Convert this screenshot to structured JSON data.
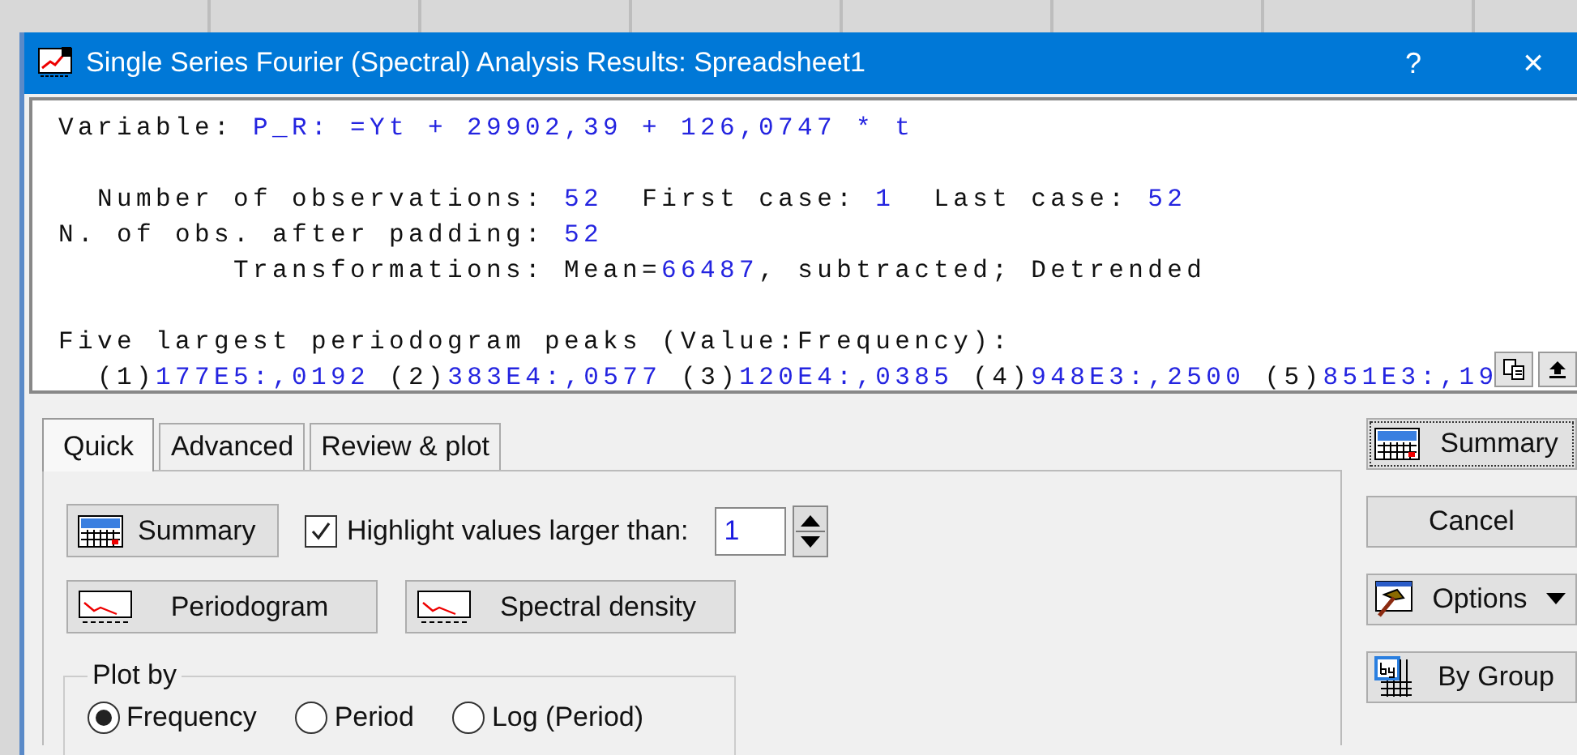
{
  "window": {
    "title": "Single Series Fourier (Spectral) Analysis Results: Spreadsheet1",
    "help": "?",
    "close": "×"
  },
  "output": {
    "blocks": [
      {
        "lines": [
          [
            {
              "kind": "label",
              "text": "Variable: "
            },
            {
              "kind": "value",
              "text": "P_R: =Yt + 29902,39 + 126,0747 * t"
            }
          ]
        ]
      },
      {
        "lines": [
          [
            {
              "kind": "label",
              "text": "  Number of observations: "
            },
            {
              "kind": "value",
              "text": "52"
            },
            {
              "kind": "label",
              "text": "  First case: "
            },
            {
              "kind": "value",
              "text": "1"
            },
            {
              "kind": "label",
              "text": "  Last case: "
            },
            {
              "kind": "value",
              "text": "52"
            }
          ],
          [
            {
              "kind": "label",
              "text": "N. of obs. after padding: "
            },
            {
              "kind": "value",
              "text": "52"
            }
          ],
          [
            {
              "kind": "label",
              "text": "         Transformations: Mean="
            },
            {
              "kind": "value",
              "text": "66487"
            },
            {
              "kind": "label",
              "text": ", subtracted; Detrended"
            }
          ]
        ]
      },
      {
        "lines": [
          [
            {
              "kind": "label",
              "text": "Five largest periodogram peaks (Value:Frequency):"
            }
          ],
          [
            {
              "kind": "label",
              "text": "  (1)"
            },
            {
              "kind": "value",
              "text": "177E5:,0192"
            },
            {
              "kind": "label",
              "text": " (2)"
            },
            {
              "kind": "value",
              "text": "383E4:,0577"
            },
            {
              "kind": "label",
              "text": " (3)"
            },
            {
              "kind": "value",
              "text": "120E4:,0385"
            },
            {
              "kind": "label",
              "text": " (4)"
            },
            {
              "kind": "value",
              "text": "948E3:,2500"
            },
            {
              "kind": "label",
              "text": " (5)"
            },
            {
              "kind": "value",
              "text": "851E3:,19"
            }
          ]
        ]
      }
    ]
  },
  "tabs": [
    {
      "label": "Quick",
      "selected": true
    },
    {
      "label": "Advanced",
      "selected": false
    },
    {
      "label": "Review & plot",
      "selected": false
    }
  ],
  "quick": {
    "summary_button": "Summary",
    "highlight": {
      "label": "Highlight values larger than:",
      "checked": true,
      "value": "1"
    },
    "plot_buttons": [
      "Periodogram",
      "Spectral density"
    ],
    "plot_by": {
      "title": "Plot by",
      "options": [
        {
          "label": "Frequency",
          "selected": true
        },
        {
          "label": "Period",
          "selected": false
        },
        {
          "label": "Log (Period)",
          "selected": false
        }
      ]
    }
  },
  "side_buttons": [
    {
      "kind": "summary",
      "label": "Summary"
    },
    {
      "kind": "plain",
      "label": "Cancel"
    },
    {
      "kind": "options",
      "label": "Options"
    },
    {
      "kind": "bygroup",
      "label": "By Group"
    }
  ]
}
